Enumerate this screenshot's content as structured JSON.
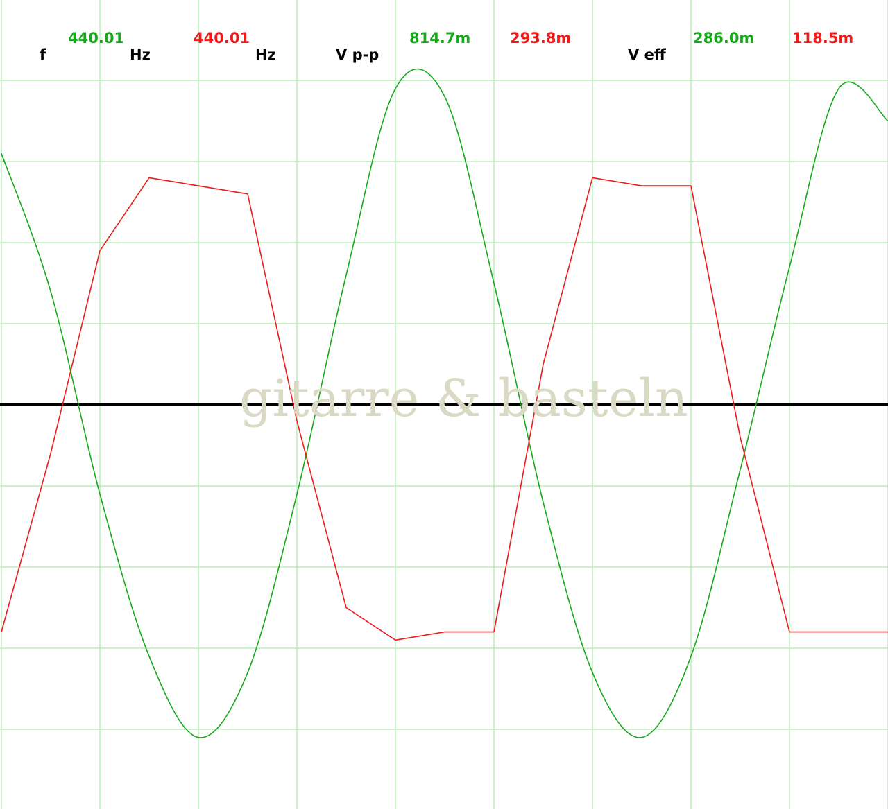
{
  "readout": {
    "f_label": "f",
    "f_ch1": "440.01",
    "f_unit_1": "Hz",
    "f_ch2": "440.01",
    "f_unit_2": "Hz",
    "vpp_label": "V p-p",
    "vpp_ch1": "814.7m",
    "vpp_ch2": "293.8m",
    "veff_label": "V eff",
    "veff_ch1": "286.0m",
    "veff_ch2": "118.5m"
  },
  "watermark": "gitarre & basteln",
  "colors": {
    "ch1": "#17a81a",
    "ch2": "#f01a1a",
    "grid": "#b6f0b6",
    "baseline": "#000000"
  },
  "chart_data": {
    "type": "line",
    "grid": true,
    "x": [
      0,
      0.5,
      1,
      1.5,
      2,
      2.5,
      3,
      3.5,
      4,
      4.5,
      5,
      5.5,
      6,
      6.5,
      7,
      7.5,
      8,
      8.5,
      9
    ],
    "series": [
      {
        "values": [
          3.1,
          1.4,
          -1.1,
          -3.1,
          -4.1,
          -3.3,
          -1.1,
          1.6,
          3.9,
          3.8,
          1.5,
          -1.2,
          -3.3,
          -4.1,
          -3.1,
          -0.8,
          1.7,
          3.9,
          3.5
        ]
      },
      {
        "values": [
          -2.8,
          -0.6,
          1.9,
          2.8,
          2.7,
          2.6,
          -0.2,
          -2.5,
          -2.9,
          -2.8,
          -2.8,
          0.5,
          2.8,
          2.7,
          2.7,
          -0.4,
          -2.8,
          -2.8,
          -2.8
        ]
      }
    ]
  }
}
